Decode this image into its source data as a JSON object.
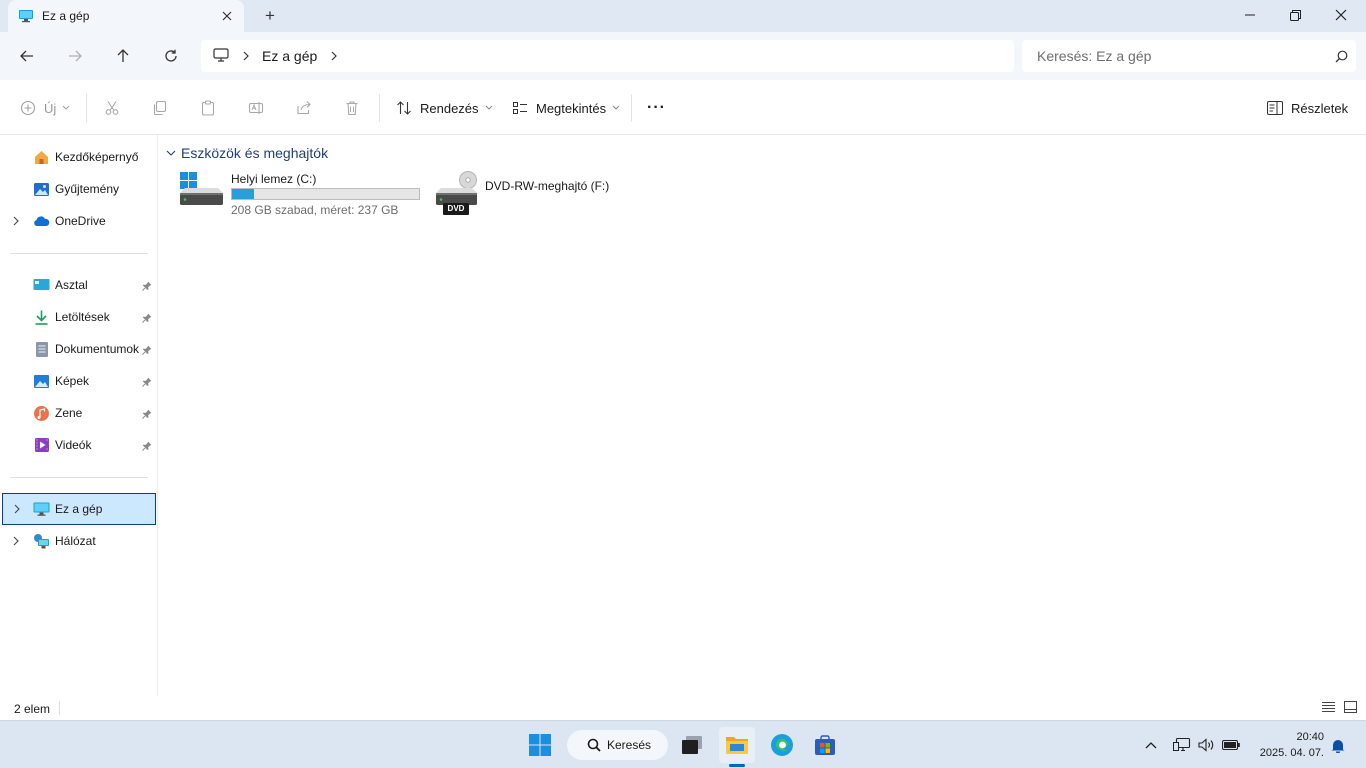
{
  "window": {
    "tab_label": "Ez a gép",
    "new_tab": "+"
  },
  "address": {
    "breadcrumb": [
      "Ez a gép"
    ],
    "search_placeholder": "Keresés: Ez a gép"
  },
  "toolbar": {
    "new_label": "Új",
    "sort_label": "Rendezés",
    "view_label": "Megtekintés",
    "more_label": "···",
    "details_label": "Részletek"
  },
  "sidebar": {
    "top": [
      {
        "label": "Kezdőképernyő",
        "icon": "home-icon"
      },
      {
        "label": "Gyűjtemény",
        "icon": "gallery-icon"
      },
      {
        "label": "OneDrive",
        "icon": "onedrive-icon"
      }
    ],
    "pinned": [
      {
        "label": "Asztal",
        "icon": "desktop-folder-icon"
      },
      {
        "label": "Letöltések",
        "icon": "download-icon"
      },
      {
        "label": "Dokumentumok",
        "icon": "documents-icon"
      },
      {
        "label": "Képek",
        "icon": "pictures-icon"
      },
      {
        "label": "Zene",
        "icon": "music-icon"
      },
      {
        "label": "Videók",
        "icon": "videos-icon"
      }
    ],
    "bottom": [
      {
        "label": "Ez a gép",
        "icon": "this-pc-icon",
        "selected": true
      },
      {
        "label": "Hálózat",
        "icon": "network-icon"
      }
    ]
  },
  "content": {
    "group_title": "Eszközök és meghajtók",
    "drives": [
      {
        "name": "Helyi lemez (C:)",
        "info": "208 GB szabad, méret: 237 GB",
        "used_fraction": 0.12
      },
      {
        "name": "DVD-RW-meghajtó (F:)",
        "badge": "DVD"
      }
    ]
  },
  "status": {
    "item_count": "2 elem"
  },
  "taskbar": {
    "search_label": "Keresés",
    "time": "20:40",
    "date": "2025. 04. 07."
  },
  "colors": {
    "accent": "#26a0da",
    "selection": "#cce8ff",
    "group_title": "#1f3e7a",
    "titlebar": "#dfe8f3",
    "taskbar": "#dce6f2"
  }
}
